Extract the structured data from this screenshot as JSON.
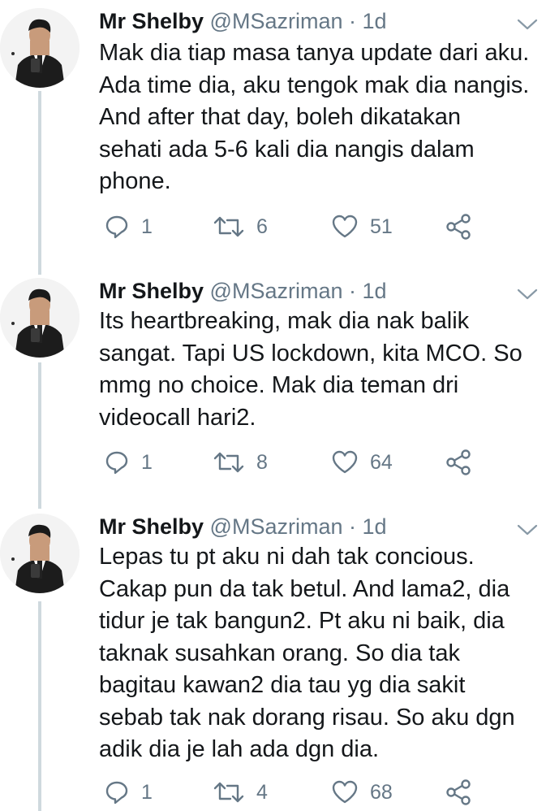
{
  "tweets": [
    {
      "name": "Mr Shelby",
      "handle": "@MSazriman",
      "separator": "·",
      "time": "1d",
      "lines": [
        "Mak dia tiap masa tanya update dari aku.",
        "Ada time dia, aku tengok mak dia nangis.",
        "And after that day, boleh dikatakan",
        "sehati ada 5-6 kali dia nangis dalam",
        "phone."
      ],
      "replies": "1",
      "retweets": "6",
      "likes": "51"
    },
    {
      "name": "Mr Shelby",
      "handle": "@MSazriman",
      "separator": "·",
      "time": "1d",
      "lines": [
        "Its heartbreaking, mak dia nak balik",
        "sangat. Tapi US lockdown, kita MCO. So",
        "mmg no choice. Mak dia teman dri",
        "videocall hari2."
      ],
      "replies": "1",
      "retweets": "8",
      "likes": "64"
    },
    {
      "name": "Mr Shelby",
      "handle": "@MSazriman",
      "separator": "·",
      "time": "1d",
      "lines": [
        "Lepas tu pt aku ni dah tak concious.",
        "Cakap pun da tak betul. And lama2, dia",
        "tidur je tak bangun2. Pt aku ni baik, dia",
        "taknak susahkan orang. So dia tak",
        "bagitau kawan2 dia tau yg dia sakit",
        "sebab tak nak dorang risau. So aku dgn",
        "adik dia je lah ada dgn dia."
      ],
      "replies": "1",
      "retweets": "4",
      "likes": "68"
    }
  ],
  "icons": {
    "reply": "reply-icon",
    "retweet": "retweet-icon",
    "like": "heart-icon",
    "share": "share-icon",
    "more": "chevron-down-icon"
  },
  "colors": {
    "text": "#14171a",
    "secondary": "#657786",
    "thread_line": "#cfd9de",
    "background": "#ffffff"
  }
}
